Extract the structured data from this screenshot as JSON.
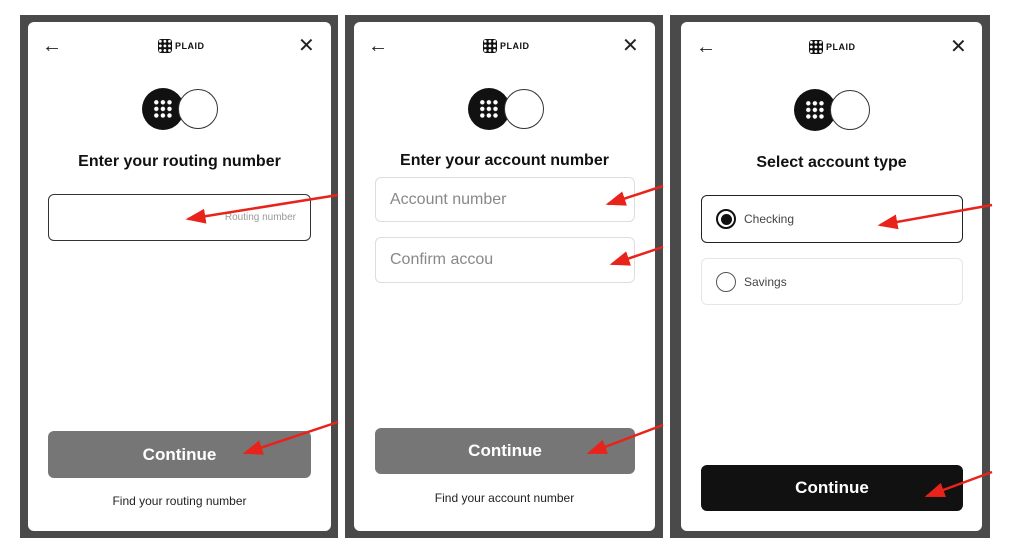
{
  "brand": "PLAID",
  "colors": {
    "accent_red": "#e8231b",
    "disabled_button": "#767676",
    "primary_button": "#111111"
  },
  "icons": {
    "back": "arrow-left-icon",
    "close": "close-icon"
  },
  "screens": [
    {
      "title": "Enter your routing number",
      "input_placeholder": "Routing number",
      "button": "Continue",
      "link": "Find your routing number"
    },
    {
      "title": "Enter your account number",
      "input1_placeholder": "Account number",
      "input2_placeholder": "Confirm accou",
      "button": "Continue",
      "link": "Find your account number"
    },
    {
      "title": "Select account type",
      "options": [
        {
          "label": "Checking",
          "selected": true
        },
        {
          "label": "Savings",
          "selected": false
        }
      ],
      "button": "Continue"
    }
  ]
}
